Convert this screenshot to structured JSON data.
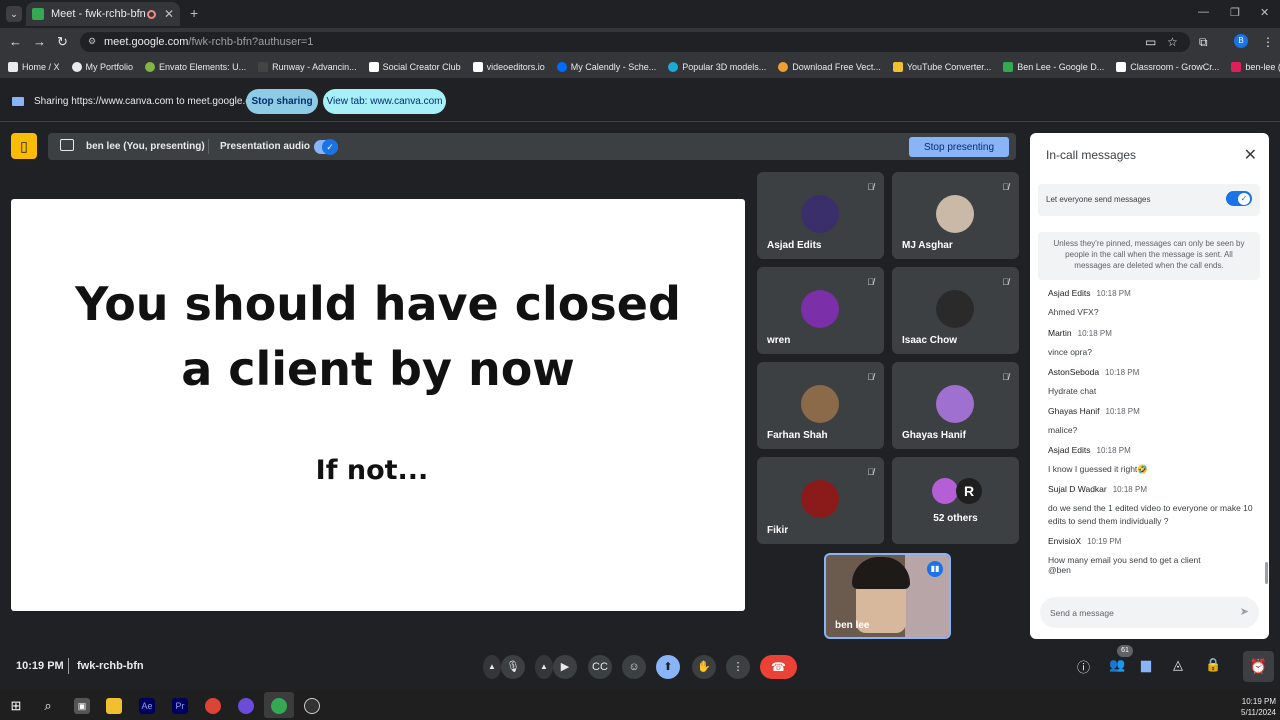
{
  "browser": {
    "tab_title": "Meet - fwk-rchb-bfn",
    "url_host": "meet.google.com",
    "url_path": "/fwk-rchb-bfn?authuser=1",
    "profile_initial": "B",
    "bookmarks": [
      {
        "label": "Home / X",
        "icon": "x-logo-icon"
      },
      {
        "label": "My Portfolio",
        "icon": "globe-icon"
      },
      {
        "label": "Envato Elements: U...",
        "icon": "envato-icon"
      },
      {
        "label": "Runway - Advancin...",
        "icon": "runway-icon"
      },
      {
        "label": "Social Creator Club",
        "icon": "scc-icon"
      },
      {
        "label": "videoeditors.io",
        "icon": "ve-icon"
      },
      {
        "label": "My Calendly - Sche...",
        "icon": "calendly-icon"
      },
      {
        "label": "Popular 3D models...",
        "icon": "sketchfab-icon"
      },
      {
        "label": "Download Free Vect...",
        "icon": "freepik-icon"
      },
      {
        "label": "YouTube Converter...",
        "icon": "converter-icon"
      },
      {
        "label": "Ben Lee - Google D...",
        "icon": "drive-icon"
      },
      {
        "label": "Classroom - GrowCr...",
        "icon": "classroom-icon"
      },
      {
        "label": "ben-lee (Channel) -...",
        "icon": "slack-icon"
      }
    ]
  },
  "sharebar": {
    "text": "Sharing https://www.canva.com to meet.google.com",
    "stop_label": "Stop sharing",
    "view_label": "View tab: www.canva.com"
  },
  "presenting": {
    "name": "ben lee (You, presenting)",
    "audio_label": "Presentation audio",
    "stop_label": "Stop presenting"
  },
  "slide": {
    "line1": "You should have closed",
    "line2": "a client by now",
    "line3": "If not..."
  },
  "participants": [
    {
      "name": "Asjad Edits",
      "color": "#3a2f6b"
    },
    {
      "name": "MJ Asghar",
      "color": "#c9b9a6"
    },
    {
      "name": "wren",
      "color": "#7b2fa8"
    },
    {
      "name": "Isaac Chow",
      "color": "#2a2a2a"
    },
    {
      "name": "Farhan Shah",
      "color": "#8b6a4a"
    },
    {
      "name": "Ghayas Hanif",
      "color": "#a070d0"
    },
    {
      "name": "Fikir",
      "color": "#8b1a1a"
    }
  ],
  "others": {
    "label": "52 others"
  },
  "self": {
    "name": "ben lee"
  },
  "chat": {
    "title": "In-call messages",
    "let_everyone": "Let everyone send messages",
    "note": "Unless they're pinned, messages can only be seen by people in the call when the message is sent. All messages are deleted when the call ends.",
    "messages": [
      {
        "who": "Asjad Edits",
        "time": "10:18 PM",
        "text": "Ahmed VFX?"
      },
      {
        "who": "Martin",
        "time": "10:18 PM",
        "text": "vince opra?"
      },
      {
        "who": "AstonSeboda",
        "time": "10:18 PM",
        "text": "Hydrate chat"
      },
      {
        "who": "Ghayas Hanif",
        "time": "10:18 PM",
        "text": "malice?"
      },
      {
        "who": "Asjad Edits",
        "time": "10:18 PM",
        "text": "I know I guessed it right🤣"
      },
      {
        "who": "Sujal D Wadkar",
        "time": "10:18 PM",
        "text": "do we send the 1 edited video to everyone or make 10 edits to send them individually ?"
      },
      {
        "who": "EnvisioX",
        "time": "10:19 PM",
        "text": "How many email you send to get a client"
      },
      {
        "who": "",
        "time": "",
        "text": "@ben"
      }
    ],
    "placeholder": "Send a message"
  },
  "footer": {
    "time": "10:19 PM",
    "meeting_code": "fwk-rchb-bfn",
    "people_count": "61"
  },
  "taskbar": {
    "time": "10:19 PM",
    "date": "5/11/2024"
  }
}
